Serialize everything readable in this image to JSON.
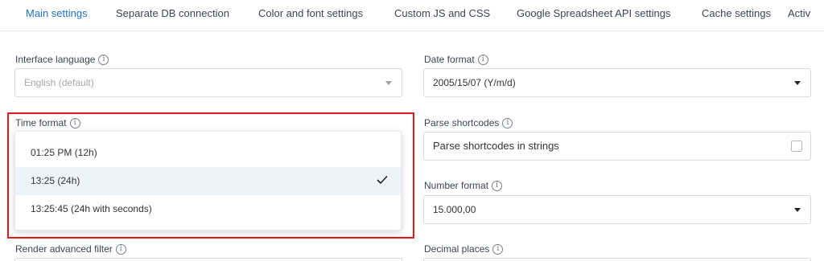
{
  "tabs": [
    {
      "label": "Main settings",
      "active": true
    },
    {
      "label": "Separate DB connection"
    },
    {
      "label": "Color and font settings"
    },
    {
      "label": "Custom JS and CSS"
    },
    {
      "label": "Google Spreadsheet API settings"
    },
    {
      "label": "Cache settings"
    },
    {
      "label": "Activ"
    }
  ],
  "interface_language": {
    "label": "Interface language",
    "value": "English (default)"
  },
  "date_format": {
    "label": "Date format",
    "value": "2005/15/07 (Y/m/d)"
  },
  "time_format": {
    "label": "Time format",
    "options": [
      "01:25 PM (12h)",
      "13:25 (24h)",
      "13:25:45 (24h with seconds)"
    ],
    "selected": "13:25 (24h)"
  },
  "parse_shortcodes": {
    "label": "Parse shortcodes",
    "checkbox_label": "Parse shortcodes in strings",
    "checked": false
  },
  "number_format": {
    "label": "Number format",
    "value": "15.000,00"
  },
  "render_advanced_filter": {
    "label": "Render advanced filter"
  },
  "decimal_places": {
    "label": "Decimal places"
  },
  "colors": {
    "accent": "#1a73c8",
    "highlight": "#e0191e",
    "selected_bg": "#eef3fa"
  },
  "icons": {
    "info": "info-icon",
    "caret": "caret-down-icon",
    "check": "check-icon"
  }
}
